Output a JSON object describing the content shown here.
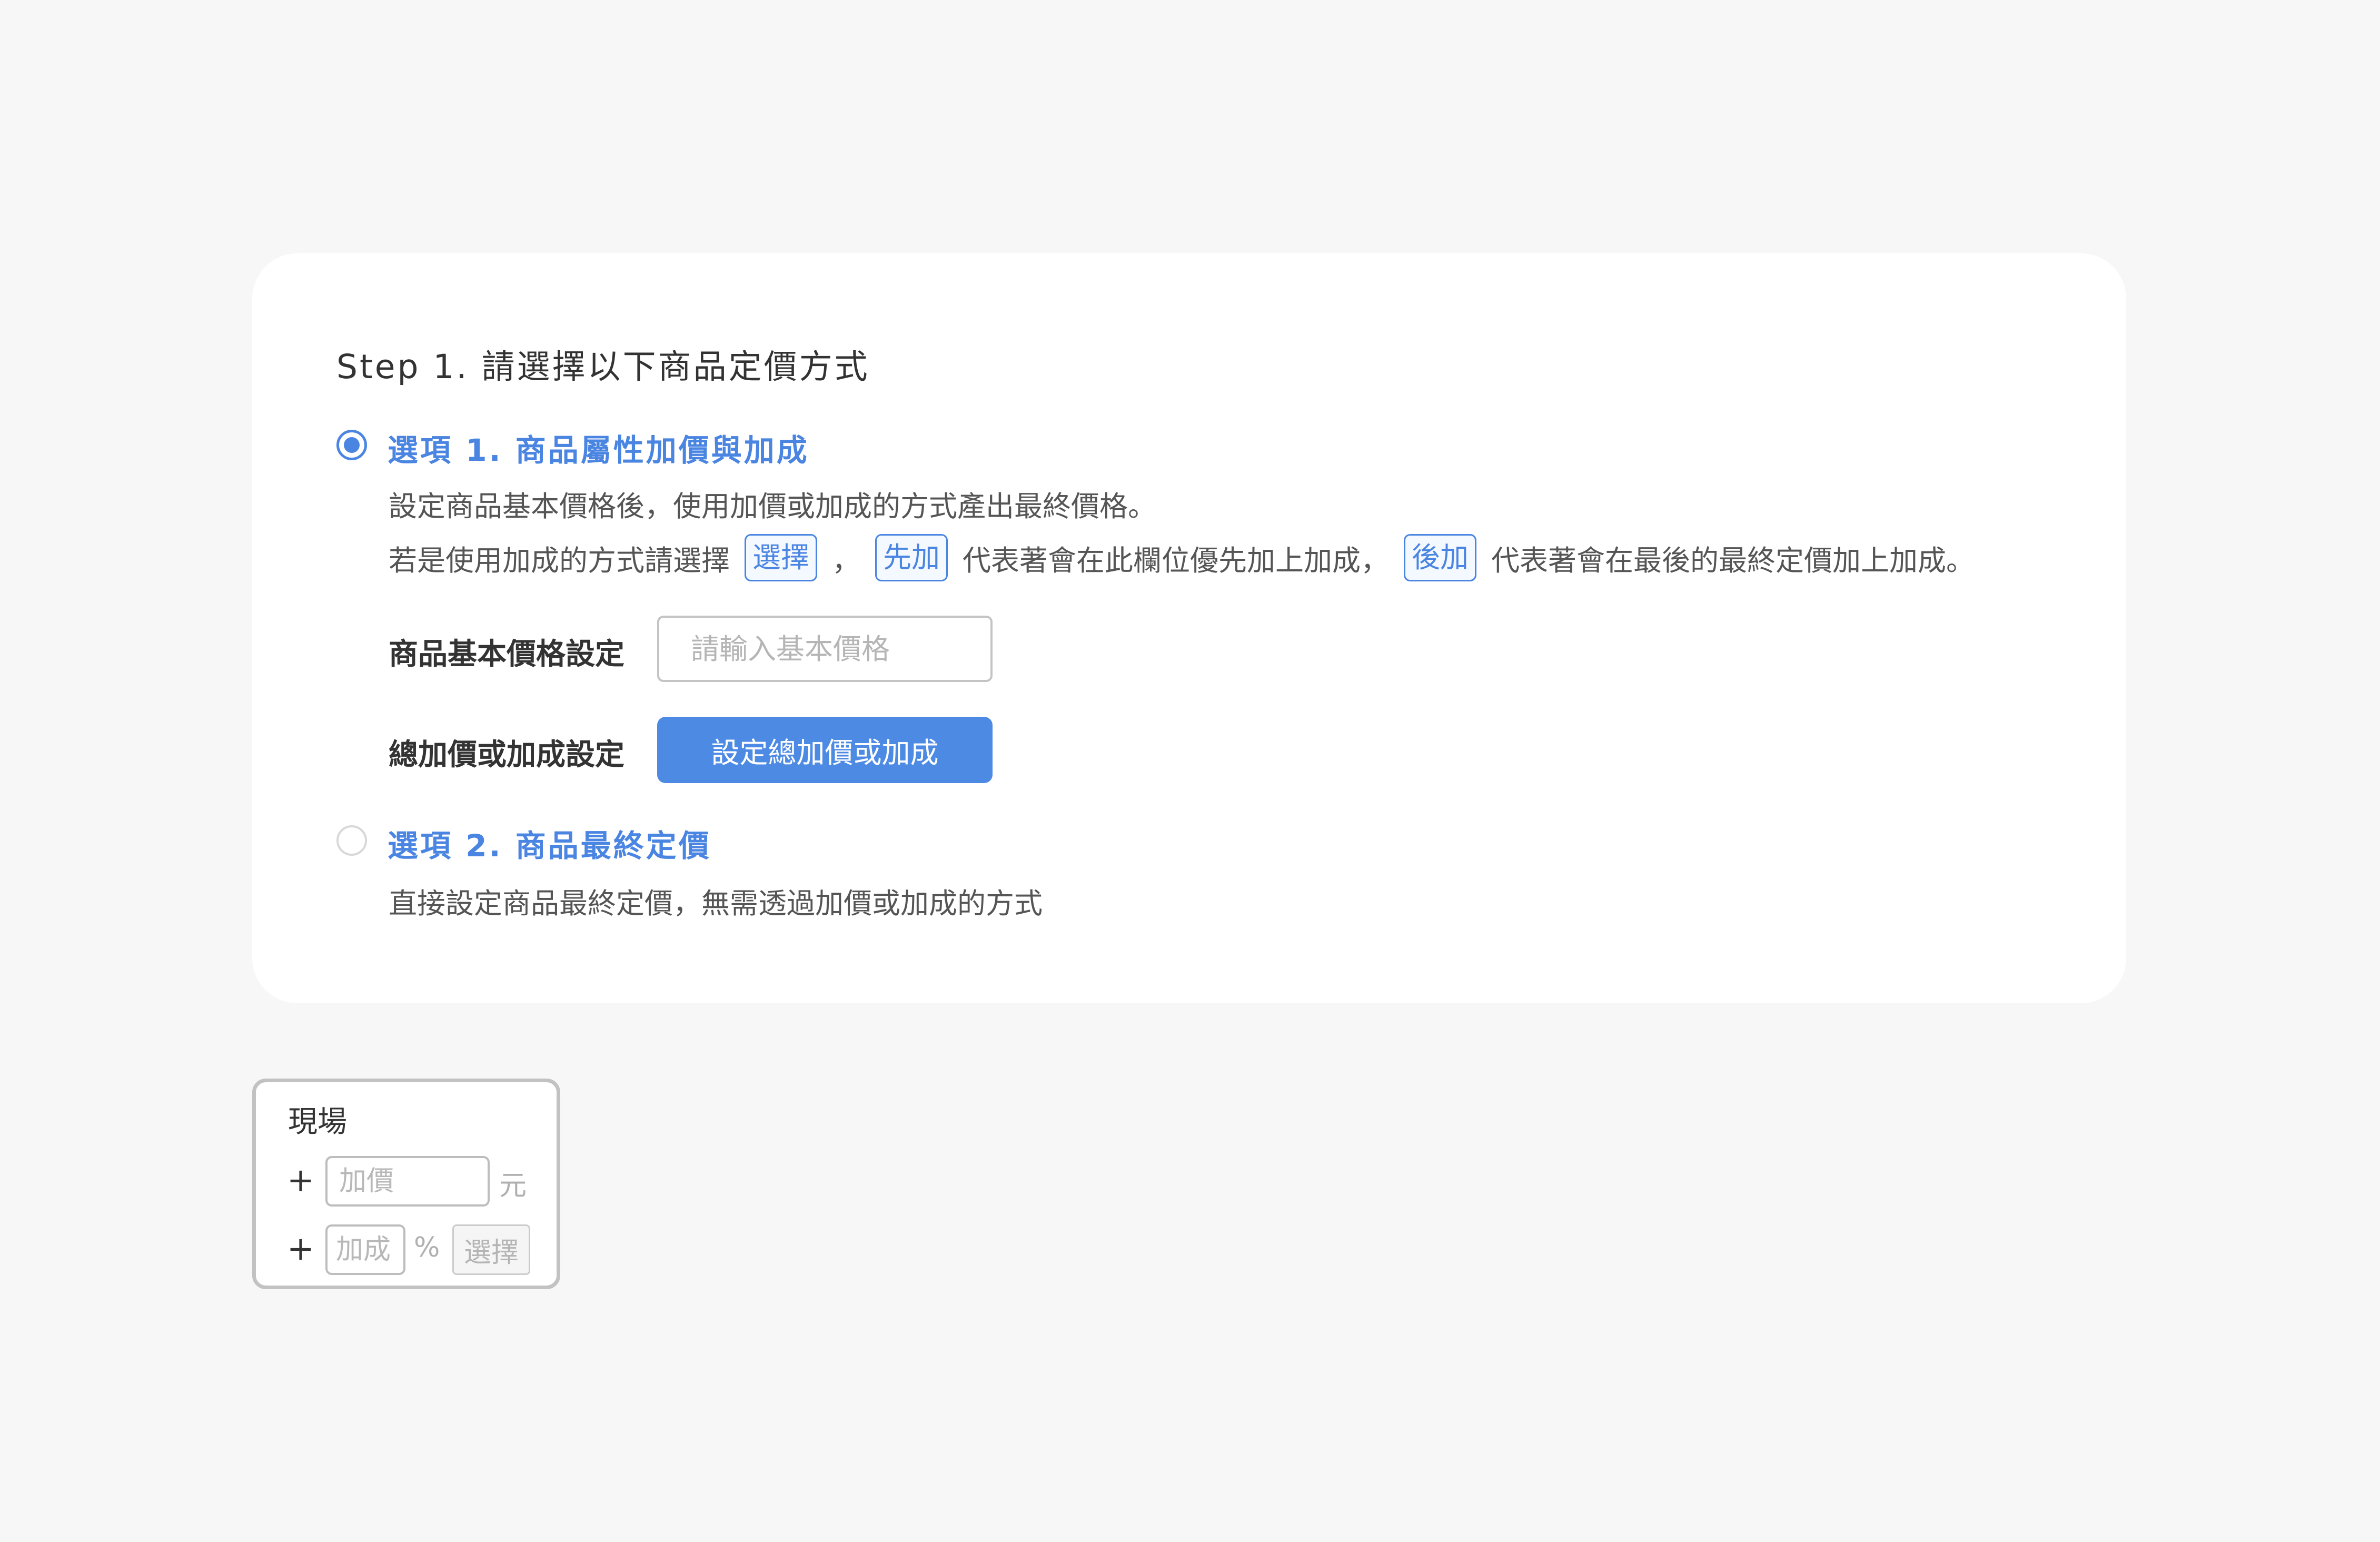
{
  "step_title": "Step 1. 請選擇以下商品定價方式",
  "option1": {
    "label": "選項 1. 商品屬性加價與加成",
    "selected": true,
    "desc_line1": "設定商品基本價格後，使用加價或加成的方式產出最終價格。",
    "desc_line2": {
      "prefix": "若是使用加成的方式請選擇",
      "tag_select": "選擇",
      "comma": "，",
      "tag_first": "先加",
      "middle": "代表著會在此欄位優先加上加成，",
      "tag_after": "後加",
      "suffix": "代表著會在最後的最終定價加上加成。"
    },
    "base_price_label": "商品基本價格設定",
    "base_price_placeholder": "請輸入基本價格",
    "base_price_value": "",
    "total_markup_label": "總加價或加成設定",
    "total_markup_button": "設定總加價或加成"
  },
  "option2": {
    "label": "選項 2. 商品最終定價",
    "selected": false,
    "desc": "直接設定商品最終定價，無需透過加價或加成的方式"
  },
  "preview": {
    "title": "現場",
    "row1": {
      "plus": "+",
      "placeholder": "加價",
      "unit": "元"
    },
    "row2": {
      "plus": "+",
      "placeholder": "加成",
      "unit": "%",
      "select_label": "選擇"
    }
  },
  "colors": {
    "accent": "#4a85e2",
    "button": "#4d8ae4",
    "background": "#f7f7f7",
    "card": "#ffffff"
  }
}
